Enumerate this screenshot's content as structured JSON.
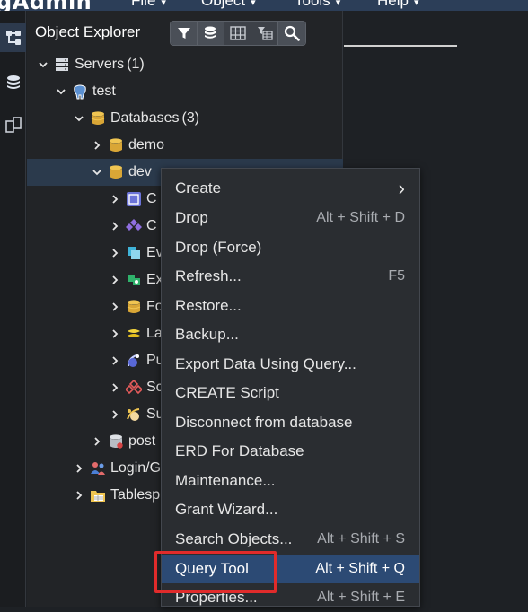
{
  "app": {
    "brand": "gAdmin",
    "menus": [
      {
        "label": "File"
      },
      {
        "label": "Object"
      },
      {
        "label": "Tools"
      },
      {
        "label": "Help"
      }
    ]
  },
  "panel": {
    "title": "Object Explorer",
    "toolbar": [
      "filter-icon",
      "database-search-icon",
      "table-icon",
      "filtered-table-icon",
      "search-icon"
    ]
  },
  "tree": [
    {
      "label": "Servers",
      "count": "(1)",
      "icon": "servers-icon",
      "chevron": "down"
    },
    {
      "label": "test",
      "count": "",
      "icon": "postgres-elephant-icon",
      "chevron": "down"
    },
    {
      "label": "Databases",
      "count": "(3)",
      "icon": "databases-icon",
      "chevron": "down"
    },
    {
      "label": "demo",
      "count": "",
      "icon": "database-icon",
      "chevron": "right"
    },
    {
      "label": "dev",
      "count": "",
      "icon": "database-icon",
      "chevron": "down",
      "selected": true
    },
    {
      "label": "C",
      "count": "",
      "icon": "casts-icon",
      "chevron": "right"
    },
    {
      "label": "C",
      "count": "",
      "icon": "catalogs-icon",
      "chevron": "right"
    },
    {
      "label": "Ev",
      "count": "",
      "icon": "event-triggers-icon",
      "chevron": "right"
    },
    {
      "label": "Ex",
      "count": "",
      "icon": "extensions-icon",
      "chevron": "right"
    },
    {
      "label": "Fo",
      "count": "",
      "icon": "foreign-data-wrappers-icon",
      "chevron": "right"
    },
    {
      "label": "La",
      "count": "",
      "icon": "languages-icon",
      "chevron": "right"
    },
    {
      "label": "Pu",
      "count": "",
      "icon": "publications-icon",
      "chevron": "right"
    },
    {
      "label": "Sc",
      "count": "",
      "icon": "schemas-icon",
      "chevron": "right"
    },
    {
      "label": "Su",
      "count": "",
      "icon": "subscriptions-icon",
      "chevron": "right"
    },
    {
      "label": "post",
      "count": "",
      "icon": "database-disconnected-icon",
      "chevron": "right"
    },
    {
      "label": "Login/G",
      "count": "",
      "icon": "login-roles-icon",
      "chevron": "right"
    },
    {
      "label": "Tablesp",
      "count": "",
      "icon": "tablespaces-icon",
      "chevron": "right"
    }
  ],
  "context_menu": {
    "items": [
      {
        "label": "Create",
        "shortcut": "›",
        "submenu": true
      },
      {
        "label": "Drop",
        "shortcut": "Alt + Shift + D"
      },
      {
        "label": "Drop (Force)",
        "shortcut": ""
      },
      {
        "label": "Refresh...",
        "shortcut": "F5"
      },
      {
        "label": "Restore...",
        "shortcut": ""
      },
      {
        "label": "Backup...",
        "shortcut": ""
      },
      {
        "label": "Export Data Using Query...",
        "shortcut": ""
      },
      {
        "label": "CREATE Script",
        "shortcut": ""
      },
      {
        "label": "Disconnect from database",
        "shortcut": ""
      },
      {
        "label": "ERD For Database",
        "shortcut": ""
      },
      {
        "label": "Maintenance...",
        "shortcut": ""
      },
      {
        "label": "Grant Wizard...",
        "shortcut": ""
      },
      {
        "label": "Search Objects...",
        "shortcut": "Alt + Shift + S"
      },
      {
        "label": "Query Tool",
        "shortcut": "Alt + Shift + Q",
        "active": true
      },
      {
        "label": "Properties...",
        "shortcut": "Alt + Shift + E"
      }
    ]
  },
  "colors": {
    "accent": "#2c4a74",
    "highlight_box": "#e02b2b",
    "db_icon": "#e8b84a"
  }
}
